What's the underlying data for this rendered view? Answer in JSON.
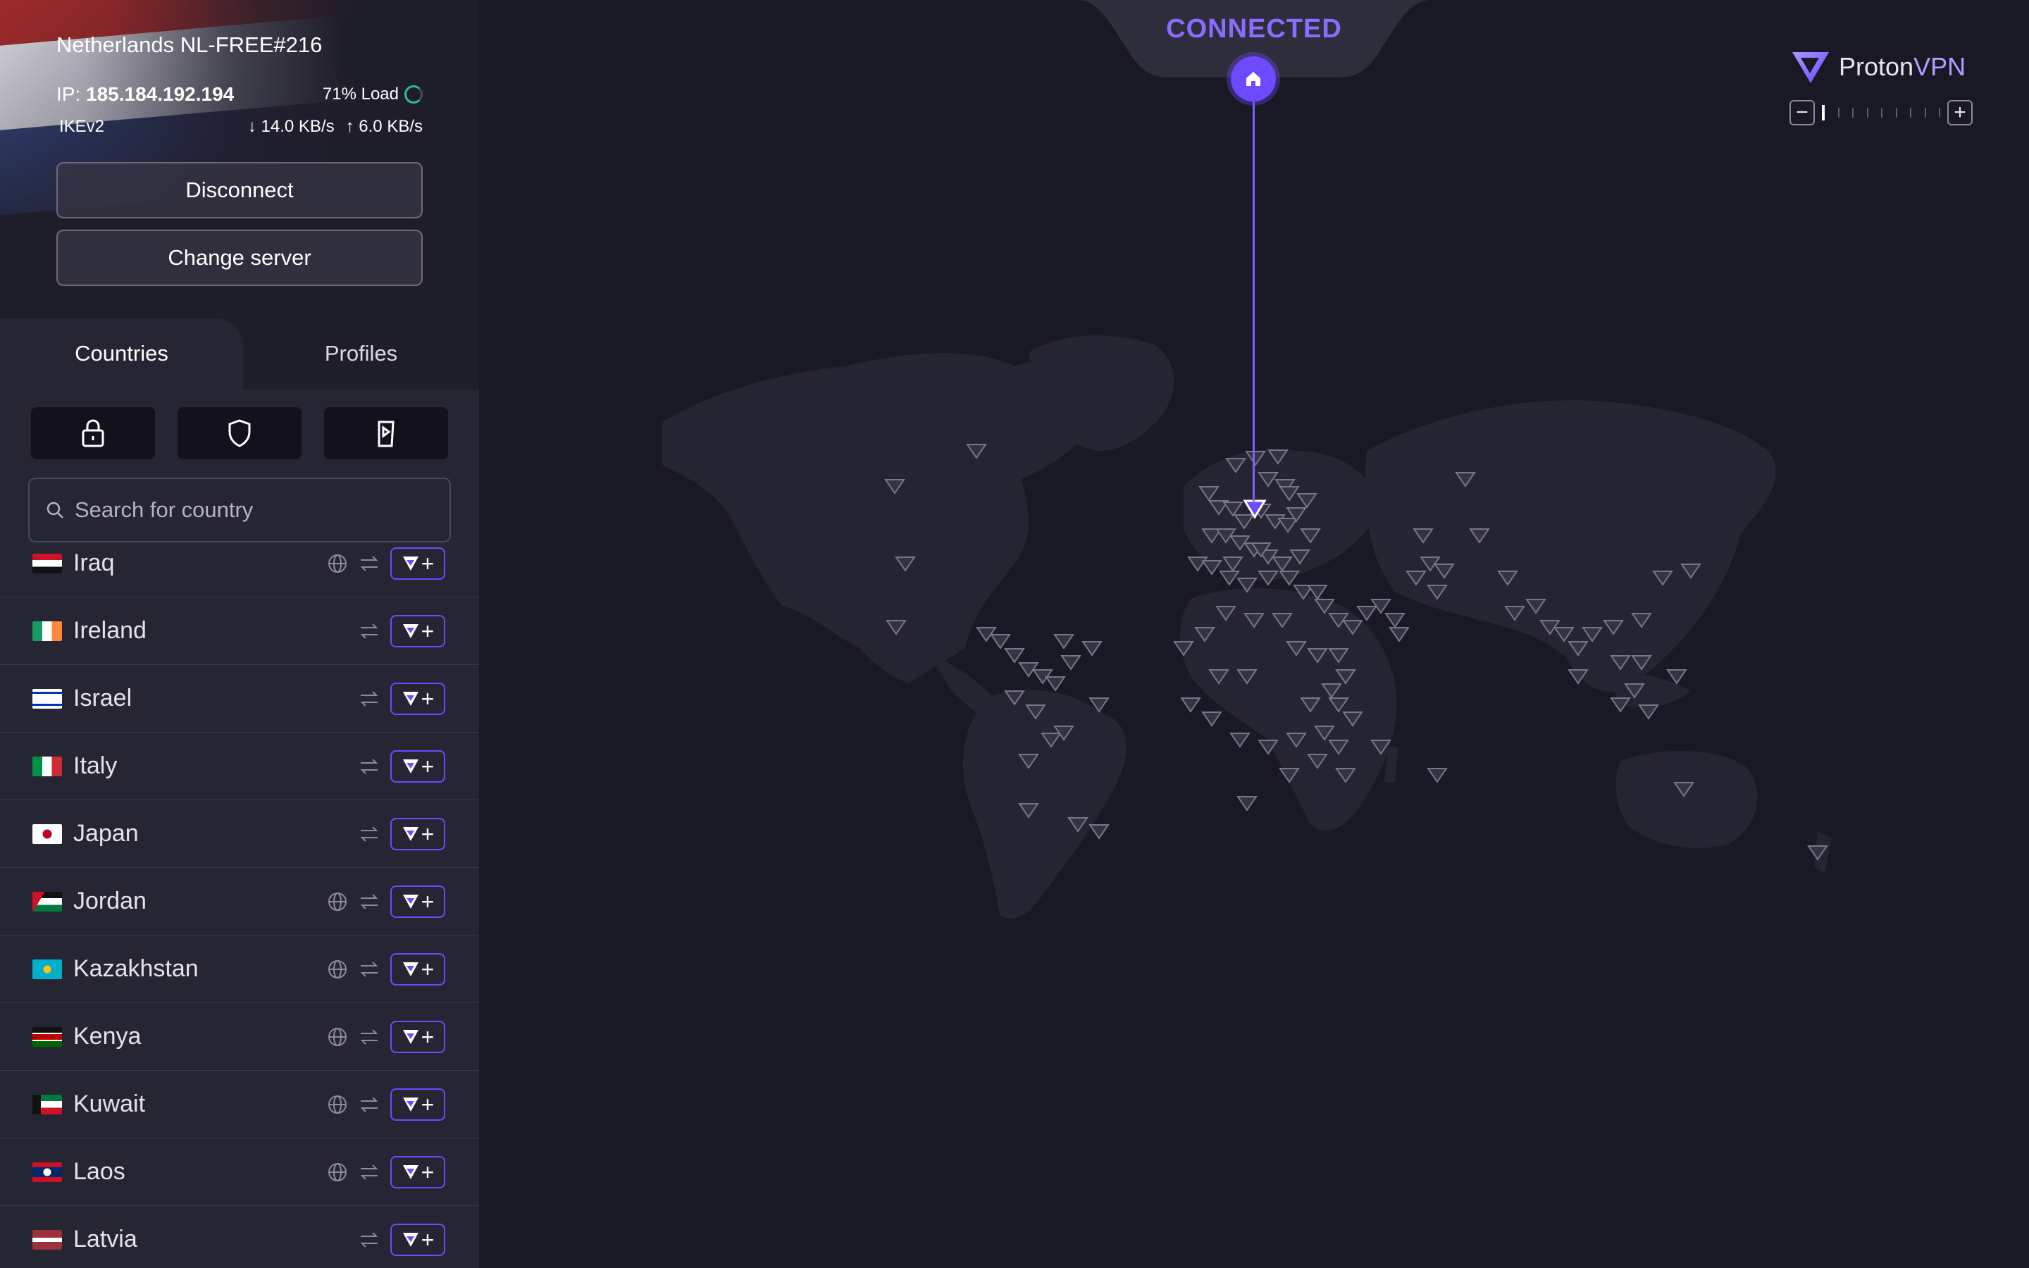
{
  "connection": {
    "server_name": "Netherlands NL-FREE#216",
    "ip_label": "IP: ",
    "ip": "185.184.192.194",
    "load": "71% Load",
    "protocol": "IKEv2",
    "download": "14.0 KB/s",
    "upload": "6.0 KB/s",
    "disconnect_label": "Disconnect",
    "change_server_label": "Change server"
  },
  "tabs": {
    "countries": "Countries",
    "profiles": "Profiles",
    "active": "Countries"
  },
  "filters": [
    {
      "icon": "lock-icon",
      "name": "secure-core-filter"
    },
    {
      "icon": "shield-icon",
      "name": "netshield-filter"
    },
    {
      "icon": "streaming-icon",
      "name": "streaming-filter"
    }
  ],
  "search": {
    "placeholder": "Search for country"
  },
  "countries": [
    {
      "name": "Iraq",
      "tor": true,
      "p2p": true
    },
    {
      "name": "Ireland",
      "tor": false,
      "p2p": true
    },
    {
      "name": "Israel",
      "tor": false,
      "p2p": true
    },
    {
      "name": "Italy",
      "tor": false,
      "p2p": true
    },
    {
      "name": "Japan",
      "tor": false,
      "p2p": true
    },
    {
      "name": "Jordan",
      "tor": true,
      "p2p": true
    },
    {
      "name": "Kazakhstan",
      "tor": true,
      "p2p": true
    },
    {
      "name": "Kenya",
      "tor": true,
      "p2p": true
    },
    {
      "name": "Kuwait",
      "tor": true,
      "p2p": true
    },
    {
      "name": "Laos",
      "tor": true,
      "p2p": true
    },
    {
      "name": "Latvia",
      "tor": false,
      "p2p": true
    }
  ],
  "map": {
    "status": "CONNECTED",
    "brand_left": "Proton",
    "brand_right": "VPN",
    "zoom_level": 1,
    "zoom_steps": 9
  },
  "colors": {
    "accent": "#6d4aff",
    "status": "#8c6bff",
    "load_ring": "#2ebd9b"
  }
}
